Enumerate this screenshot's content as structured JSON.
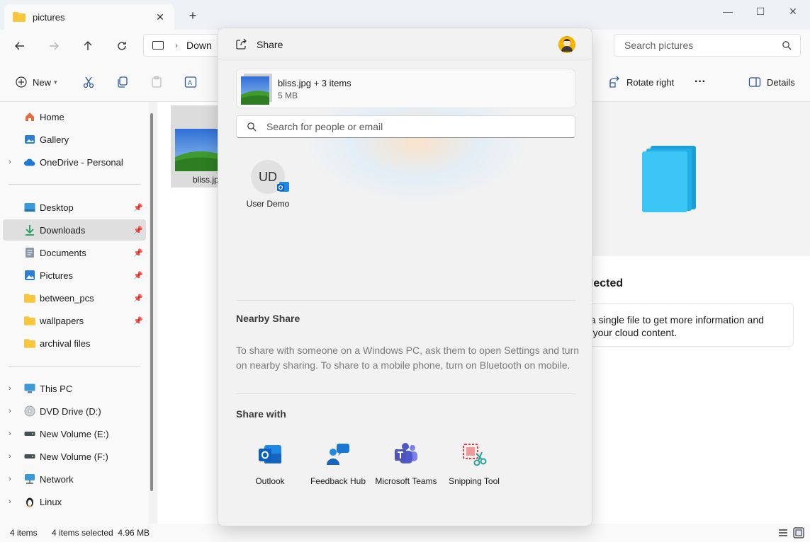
{
  "tab": {
    "title": "pictures",
    "close": "✕",
    "new_tab": "+"
  },
  "window_controls": {
    "minimize": "—",
    "maximize": "☐",
    "close": "✕"
  },
  "address": {
    "segment": "Down",
    "separator": "›"
  },
  "search": {
    "placeholder": "Search pictures"
  },
  "toolbar": {
    "new_label": "New",
    "rotate_right_label": "Rotate right",
    "more_label": "···",
    "details_label": "Details"
  },
  "sidebar": {
    "items": [
      {
        "label": "Home"
      },
      {
        "label": "Gallery"
      },
      {
        "label": "OneDrive - Personal"
      },
      {
        "label": "Desktop"
      },
      {
        "label": "Downloads"
      },
      {
        "label": "Documents"
      },
      {
        "label": "Pictures"
      },
      {
        "label": "between_pcs"
      },
      {
        "label": "wallpapers"
      },
      {
        "label": "archival files"
      },
      {
        "label": "This PC"
      },
      {
        "label": "DVD Drive (D:)"
      },
      {
        "label": "New Volume (E:)"
      },
      {
        "label": "New Volume (F:)"
      },
      {
        "label": "Network"
      },
      {
        "label": "Linux"
      }
    ]
  },
  "content": {
    "file_name": "bliss.jpg"
  },
  "details_pane": {
    "title": "elected",
    "text_line1": "t a single file to get more information and",
    "text_line2": "e your cloud content."
  },
  "status": {
    "items_count": "4 items",
    "selected": "4 items selected  4.96 MB"
  },
  "share": {
    "title": "Share",
    "file_summary": "bliss.jpg + 3 items",
    "file_size": "5 MB",
    "search_placeholder": "Search for people or email",
    "contact": {
      "initials": "UD",
      "name": "User Demo"
    },
    "nearby_title": "Nearby Share",
    "nearby_text": "To share with someone on a Windows PC, ask them to open Settings and turn on nearby sharing. To share to a mobile phone, turn on Bluetooth on mobile.",
    "share_with_title": "Share with",
    "apps": [
      {
        "label": "Outlook"
      },
      {
        "label": "Feedback Hub"
      },
      {
        "label": "Microsoft Teams"
      },
      {
        "label": "Snipping Tool"
      }
    ]
  },
  "colors": {
    "accent": "#0067c0",
    "folder": "#f8c73e",
    "selected_bg": "#dfdfdf"
  }
}
